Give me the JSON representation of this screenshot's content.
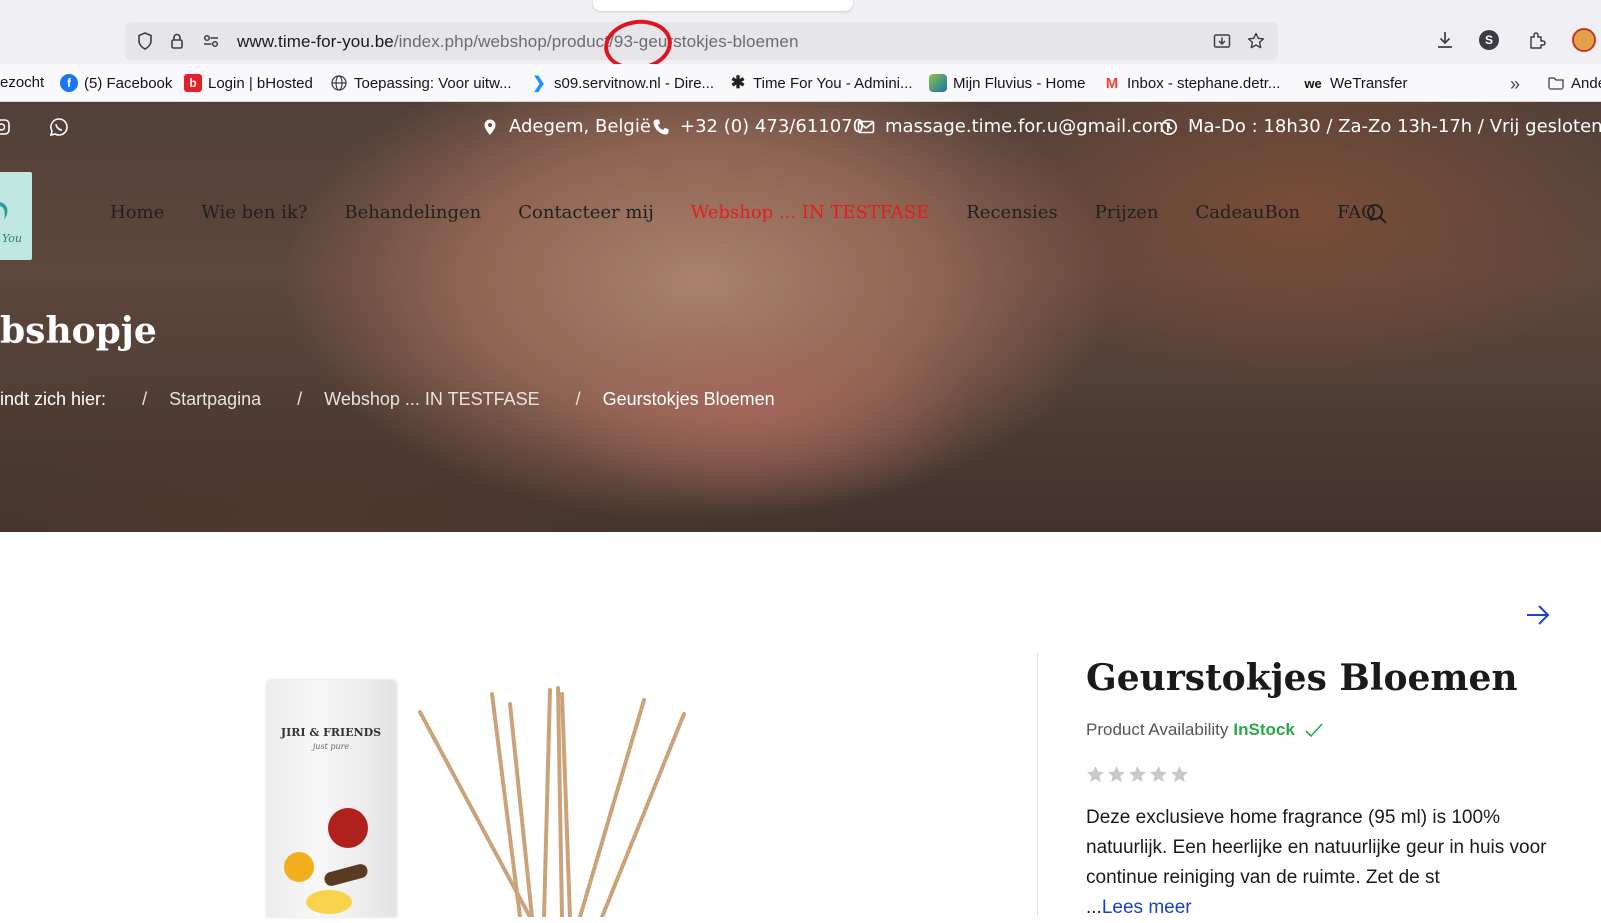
{
  "browser": {
    "url_host": "www.time-for-you.be",
    "url_path": "/index.php/webshop/product/93-geurstokjes-bloemen",
    "profile_initial": "S"
  },
  "bookmarks": [
    {
      "label": "ezocht",
      "icon": "none"
    },
    {
      "label": "(5) Facebook",
      "icon": "facebook-icon"
    },
    {
      "label": "Login | bHosted",
      "icon": "bhosted-icon"
    },
    {
      "label": "Toepassing: Voor uitw...",
      "icon": "globe-icon"
    },
    {
      "label": "s09.servitnow.nl - Dire...",
      "icon": "servitnow-icon"
    },
    {
      "label": "Time For You - Admini...",
      "icon": "joomla-icon"
    },
    {
      "label": "Mijn Fluvius - Home",
      "icon": "fluvius-icon"
    },
    {
      "label": "Inbox - stephane.detr...",
      "icon": "gmail-icon"
    },
    {
      "label": "WeTransfer",
      "icon": "wetransfer-icon"
    }
  ],
  "bookmarks_overflow_label": "Ande",
  "site": {
    "top_info": {
      "location": "Adegem, België",
      "phone": "+32 (0) 473/611070",
      "email": "massage.time.for.u@gmail.com",
      "hours": "Ma-Do : 18h30 / Za-Zo 13h-17h / Vrij gesloten"
    },
    "logo_text": "You",
    "nav": [
      "Home",
      "Wie ben ik?",
      "Behandelingen",
      "Contacteer mij",
      "Webshop ... IN TESTFASE",
      "Recensies",
      "Prijzen",
      "CadeauBon",
      "FAQ"
    ],
    "nav_active_index": 4,
    "page_title": "bshopje",
    "breadcrumb": {
      "lead": "indt zich hier:",
      "items": [
        "Startpagina",
        "Webshop ... IN TESTFASE",
        "Geurstokjes Bloemen"
      ]
    }
  },
  "product": {
    "box_brand": "JIRI & FRIENDS",
    "box_sub": "just pure",
    "title": "Geurstokjes Bloemen",
    "availability_label": "Product Availability",
    "availability_value": "InStock",
    "rating": 0,
    "rating_max": 5,
    "description": "Deze exclusieve home fragrance (95 ml) is 100% natuurlijk. Een heerlijke en natuurlijke geur in huis voor continue reiniging van de ruimte. Zet de st",
    "read_more_prefix": "...",
    "read_more": "Lees meer"
  },
  "colors": {
    "accent_red": "#e51c1c",
    "instock_green": "#2aa84a",
    "link_blue": "#1b3fcf"
  }
}
